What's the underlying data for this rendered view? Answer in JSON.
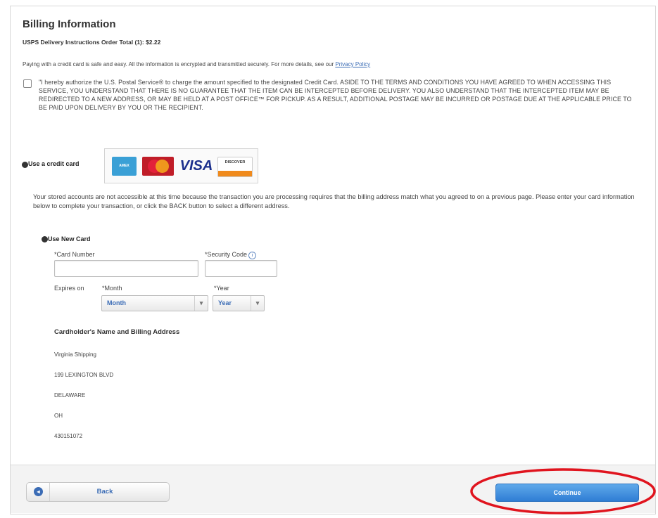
{
  "billing": {
    "title": "Billing Information",
    "subtitle": "USPS Delivery Instructions Order Total (1): $2.22",
    "intro_text": "Paying with a credit card is safe and easy. All the information is encrypted and transmitted securely. For more details, see our",
    "privacy_link": "Privacy Policy",
    "authorization_text": "\"I hereby authorize the U.S. Postal Service® to charge the amount specified to the designated Credit Card. ASIDE TO THE TERMS AND CONDITIONS YOU HAVE AGREED TO WHEN ACCESSING THIS SERVICE, YOU UNDERSTAND THAT THERE IS NO GUARANTEE THAT THE ITEM CAN BE INTERCEPTED BEFORE DELIVERY. YOU ALSO UNDERSTAND THAT THE INTERCEPTED ITEM MAY BE REDIRECTED TO A NEW ADDRESS, OR MAY BE HELD AT A POST OFFICE™ FOR PICKUP. AS A RESULT, ADDITIONAL POSTAGE MAY BE INCURRED OR POSTAGE DUE AT THE APPLICABLE PRICE TO BE PAID UPON DELIVERY BY YOU OR THE RECIPIENT."
  },
  "payment": {
    "credit_card_label": "Use a credit card",
    "card_logos": [
      "amex",
      "mastercard",
      "visa",
      "discover"
    ],
    "visa_text": "VISA",
    "discover_text": "DISCOVER",
    "stored_accounts_text": "Your stored accounts are not accessible at this time because the transaction you are processing requires that the billing address match what you agreed to on a previous page. Please enter your card information below to complete your transaction, or click the BACK button to select a different address."
  },
  "new_card": {
    "label": "Use New Card",
    "card_number_label": "*Card Number",
    "card_number_value": "",
    "security_code_label": "*Security Code",
    "security_code_value": "",
    "expires_label": "Expires on",
    "month_label": "*Month",
    "month_value": "Month",
    "year_label": "*Year",
    "year_value": "Year"
  },
  "address": {
    "heading": "Cardholder's Name and Billing Address",
    "lines": [
      "Virginia Shipping",
      "199 LEXINGTON BLVD",
      "DELAWARE",
      "OH",
      "430151072"
    ]
  },
  "footer": {
    "back_label": "Back",
    "continue_label": "Continue"
  },
  "colors": {
    "link_blue": "#3b6cb5",
    "continue_blue": "#2f7dd4",
    "highlight_red": "#e0141e"
  }
}
